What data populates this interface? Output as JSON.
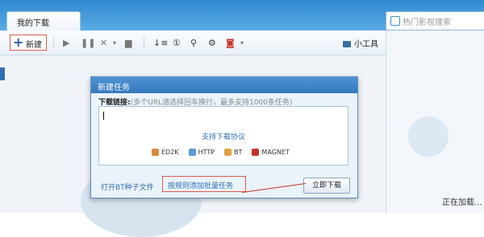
{
  "tab": {
    "my_downloads": "我的下载"
  },
  "search": {
    "placeholder": "热门影视搜索"
  },
  "toolbar": {
    "new_label": "新建",
    "tools_label": "小工具"
  },
  "dialog": {
    "title": "新建任务",
    "link_label": "下载链接:",
    "link_hint": "(多个URL请选择回车换行，最多支持1000条任务)",
    "protocols_title": "支持下载协议",
    "protocols": [
      "ED2K",
      "HTTP",
      "BT",
      "MAGNET"
    ],
    "open_bt": "打开BT种子文件",
    "batch_add": "按规则添加批量任务",
    "download_now": "立即下载"
  },
  "status": {
    "loading": "正在加载..."
  },
  "colors": {
    "accent": "#2f6db3",
    "highlight_border": "#e05a4a",
    "title_bar": "#3f85c8"
  }
}
